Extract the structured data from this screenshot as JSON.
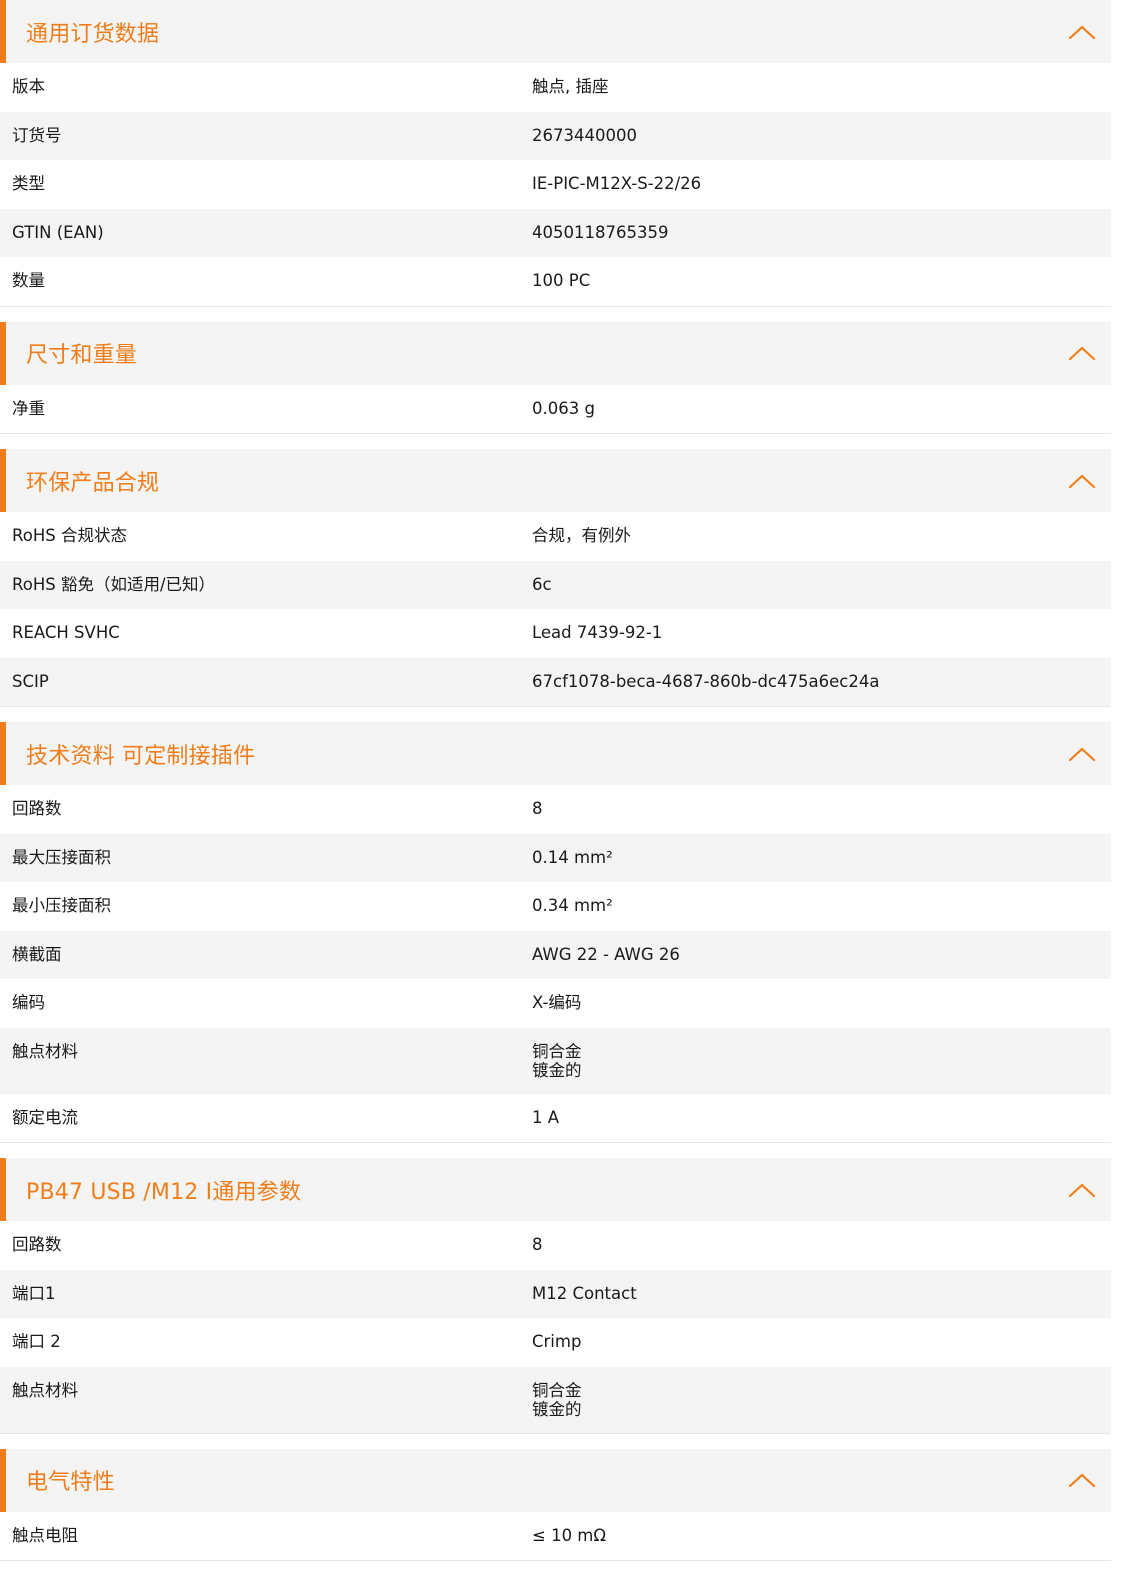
{
  "colors": {
    "accent": "#f07d19",
    "header_bg": "#f4f4f4",
    "row_alt_bg": "#f4f4f4",
    "text": "#1a1a1a"
  },
  "toggle_icon": "chevron-up-icon",
  "sections": [
    {
      "title": "通用订货数据",
      "rows": [
        {
          "label": "版本",
          "value": "触点, 插座"
        },
        {
          "label": "订货号",
          "value": "2673440000"
        },
        {
          "label": "类型",
          "value": "IE-PIC-M12X-S-22/26"
        },
        {
          "label": "GTIN (EAN)",
          "value": "4050118765359"
        },
        {
          "label": "数量",
          "value": "100  PC"
        }
      ]
    },
    {
      "title": "尺寸和重量",
      "rows": [
        {
          "label": "净重",
          "value": "0.063  g"
        }
      ]
    },
    {
      "title": "环保产品合规",
      "rows": [
        {
          "label": "RoHS 合规状态",
          "value": "合规，有例外"
        },
        {
          "label": "RoHS 豁免（如适用/已知）",
          "value": "6c"
        },
        {
          "label": "REACH SVHC",
          "value": "Lead 7439-92-1"
        },
        {
          "label": "SCIP",
          "value": "67cf1078-beca-4687-860b-dc475a6ec24a"
        }
      ]
    },
    {
      "title": "技术资料 可定制接插件",
      "rows": [
        {
          "label": "回路数",
          "value": "8"
        },
        {
          "label": "最大压接面积",
          "value": "0.14  mm²"
        },
        {
          "label": "最小压接面积",
          "value": "0.34  mm²"
        },
        {
          "label": "横截面",
          "value": "AWG 22 - AWG 26"
        },
        {
          "label": "编码",
          "value": "X-编码"
        },
        {
          "label": "触点材料",
          "value": "铜合金\n镀金的"
        },
        {
          "label": "额定电流",
          "value": "1  A"
        }
      ]
    },
    {
      "title": "PB47 USB /M12 I通用参数",
      "rows": [
        {
          "label": "回路数",
          "value": "8"
        },
        {
          "label": "端口1",
          "value": "M12 Contact"
        },
        {
          "label": "端口 2",
          "value": "Crimp"
        },
        {
          "label": "触点材料",
          "value": "铜合金\n镀金的"
        }
      ]
    },
    {
      "title": "电气特性",
      "rows": [
        {
          "label": "触点电阻",
          "value": "≤ 10 mΩ"
        }
      ]
    }
  ]
}
